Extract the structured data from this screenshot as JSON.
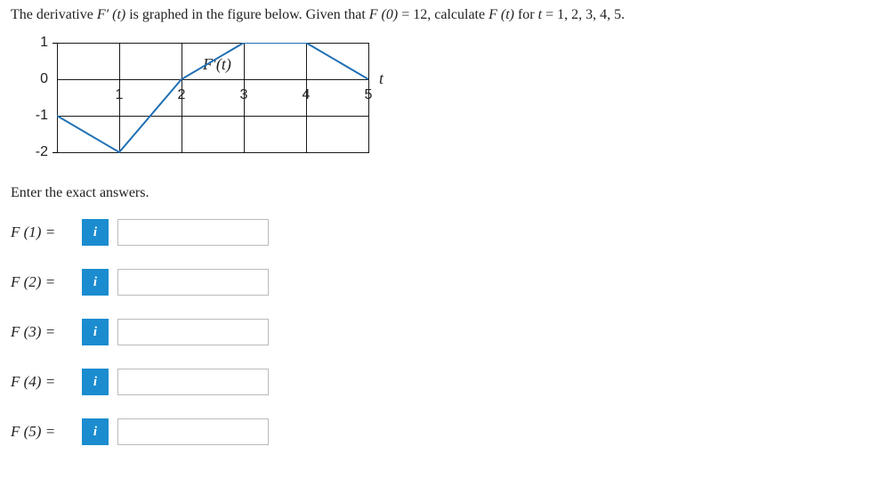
{
  "question": {
    "pre": "The derivative ",
    "fn1": "F′ (t)",
    "mid1": " is graphed in the figure below. Given that ",
    "fn2": "F (0)",
    "eq1": " = 12",
    "mid2": ", calculate ",
    "fn3": "F (t)",
    "mid3": " for ",
    "var_t": "t",
    "eq2": " = 1, 2, 3, 4, 5."
  },
  "chart_data": {
    "type": "line",
    "title": "",
    "fprime_label": "F′(t)",
    "axis_var": "t",
    "xlim": [
      0,
      5
    ],
    "ylim": [
      -2,
      1
    ],
    "x_ticks": [
      1,
      2,
      3,
      4,
      5
    ],
    "y_ticks": [
      1,
      0,
      -1,
      -2
    ],
    "series": [
      {
        "name": "F′(t)",
        "points": [
          [
            0,
            -1
          ],
          [
            1,
            -2
          ],
          [
            2,
            0
          ],
          [
            3,
            1
          ],
          [
            4,
            1
          ],
          [
            5,
            0
          ]
        ]
      }
    ]
  },
  "instructions": "Enter the exact answers.",
  "info_icon": "i",
  "answers": [
    {
      "label": "F (1) =",
      "value": ""
    },
    {
      "label": "F (2) =",
      "value": ""
    },
    {
      "label": "F (3) =",
      "value": ""
    },
    {
      "label": "F (4) =",
      "value": ""
    },
    {
      "label": "F (5) =",
      "value": ""
    }
  ]
}
